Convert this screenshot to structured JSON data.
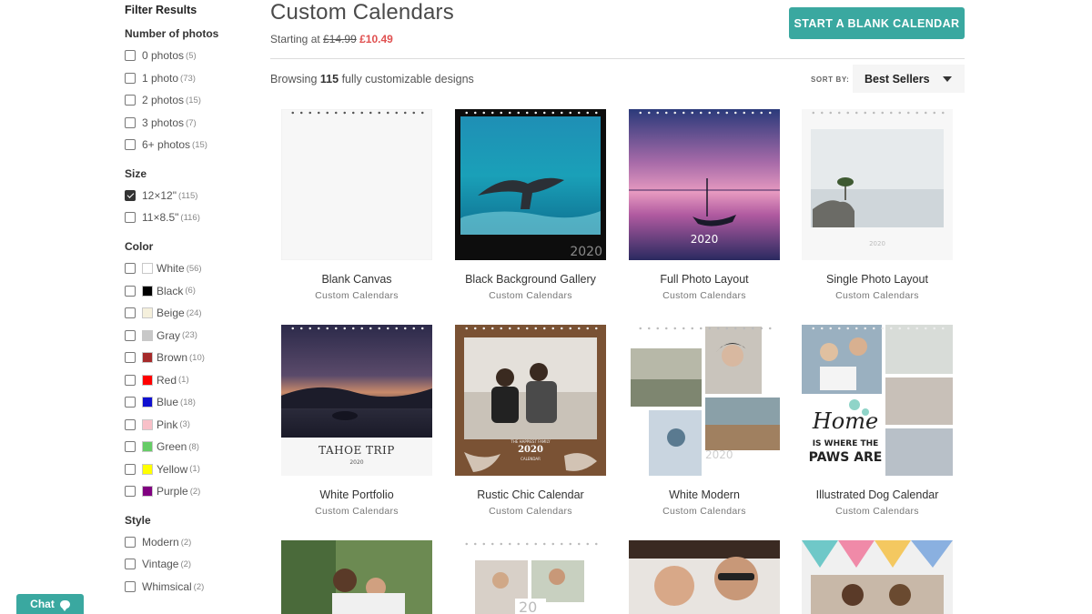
{
  "sidebar": {
    "title": "Filter Results",
    "groups": [
      {
        "title": "Number of photos",
        "options": [
          {
            "label": "0 photos",
            "count": "(5)",
            "checked": false
          },
          {
            "label": "1 photo",
            "count": "(73)",
            "checked": false
          },
          {
            "label": "2 photos",
            "count": "(15)",
            "checked": false
          },
          {
            "label": "3 photos",
            "count": "(7)",
            "checked": false
          },
          {
            "label": "6+ photos",
            "count": "(15)",
            "checked": false
          }
        ]
      },
      {
        "title": "Size",
        "options": [
          {
            "label": "12×12\"",
            "count": "(115)",
            "checked": true
          },
          {
            "label": "11×8.5\"",
            "count": "(116)",
            "checked": false
          }
        ]
      },
      {
        "title": "Color",
        "options": [
          {
            "label": "White",
            "count": "(56)",
            "swatch": "#ffffff",
            "checked": false
          },
          {
            "label": "Black",
            "count": "(6)",
            "swatch": "#000000",
            "checked": false
          },
          {
            "label": "Beige",
            "count": "(24)",
            "swatch": "#f5f0dc",
            "checked": false
          },
          {
            "label": "Gray",
            "count": "(23)",
            "swatch": "#c8c8c8",
            "checked": false
          },
          {
            "label": "Brown",
            "count": "(10)",
            "swatch": "#a52a2a",
            "checked": false
          },
          {
            "label": "Red",
            "count": "(1)",
            "swatch": "#ff0000",
            "checked": false
          },
          {
            "label": "Blue",
            "count": "(18)",
            "swatch": "#1010d0",
            "checked": false
          },
          {
            "label": "Pink",
            "count": "(3)",
            "swatch": "#f8c0c8",
            "checked": false
          },
          {
            "label": "Green",
            "count": "(8)",
            "swatch": "#66cc66",
            "checked": false
          },
          {
            "label": "Yellow",
            "count": "(1)",
            "swatch": "#ffff00",
            "checked": false
          },
          {
            "label": "Purple",
            "count": "(2)",
            "swatch": "#800080",
            "checked": false
          }
        ]
      },
      {
        "title": "Style",
        "options": [
          {
            "label": "Modern",
            "count": "(2)",
            "checked": false
          },
          {
            "label": "Vintage",
            "count": "(2)",
            "checked": false
          },
          {
            "label": "Whimsical",
            "count": "(2)",
            "checked": false
          }
        ]
      }
    ]
  },
  "header": {
    "title": "Custom Calendars",
    "price_prefix": "Starting at",
    "price_old": "£14.99",
    "price_new": "£10.49",
    "blank_button": "START A BLANK CALENDAR"
  },
  "toolbar": {
    "browsing_prefix": "Browsing",
    "browsing_count": "115",
    "browsing_suffix": "fully customizable designs",
    "sort_label": "SORT BY:",
    "sort_value": "Best Sellers"
  },
  "products": [
    {
      "name": "Blank Canvas",
      "category": "Custom Calendars"
    },
    {
      "name": "Black Background Gallery",
      "category": "Custom Calendars",
      "year": "2020"
    },
    {
      "name": "Full Photo Layout",
      "category": "Custom Calendars",
      "year": "2020"
    },
    {
      "name": "Single Photo Layout",
      "category": "Custom Calendars",
      "year": "2020"
    },
    {
      "name": "White Portfolio",
      "category": "Custom Calendars",
      "caption": "TAHOE TRIP",
      "year": "2020"
    },
    {
      "name": "Rustic Chic Calendar",
      "category": "Custom Calendars",
      "caption": "THE HAPPIEST FAMILY",
      "year": "2020",
      "subcaption": "CALENDAR"
    },
    {
      "name": "White Modern",
      "category": "Custom Calendars",
      "year": "2020"
    },
    {
      "name": "Illustrated Dog Calendar",
      "category": "Custom Calendars",
      "line1": "Home",
      "line2": "IS WHERE THE",
      "line3": "PAWS ARE"
    },
    {
      "name": "",
      "category": ""
    },
    {
      "name": "",
      "category": "",
      "year": "20"
    },
    {
      "name": "",
      "category": ""
    },
    {
      "name": "",
      "category": ""
    }
  ],
  "chat": {
    "label": "Chat"
  },
  "colors": {
    "accent": "#3aa8a0",
    "sale": "#e05050"
  }
}
